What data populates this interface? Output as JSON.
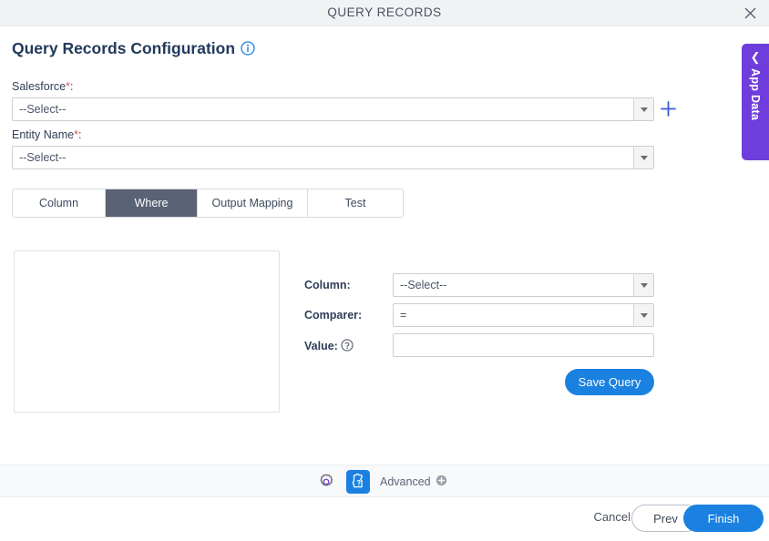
{
  "window": {
    "title": "QUERY RECORDS",
    "close_icon": "close-icon"
  },
  "page": {
    "heading": "Query Records Configuration",
    "info_icon": "info-icon"
  },
  "form": {
    "salesforce": {
      "label": "Salesforce",
      "required_mark": "*",
      "suffix": ":",
      "value": "--Select--",
      "add_icon": "plus-icon"
    },
    "entity_name": {
      "label": "Entity Name",
      "required_mark": "*",
      "suffix": ":",
      "value": "--Select--"
    }
  },
  "tabs": {
    "items": [
      {
        "label": "Column",
        "active": false
      },
      {
        "label": "Where",
        "active": true
      },
      {
        "label": "Output Mapping",
        "active": false
      },
      {
        "label": "Test",
        "active": false
      }
    ]
  },
  "criteria": {
    "list_items": [],
    "column": {
      "label": "Column:",
      "value": "--Select--"
    },
    "comparer": {
      "label": "Comparer:",
      "value": "="
    },
    "value": {
      "label": "Value:",
      "help_icon": "help-icon",
      "value": "",
      "placeholder": ""
    },
    "save_query_label": "Save Query"
  },
  "toolbar": {
    "settings_icon": "gear-icon",
    "snippet_icon": "puzzle-question-icon",
    "advanced_label": "Advanced",
    "advanced_add_icon": "plus-circle-icon"
  },
  "actions": {
    "cancel_label": "Cancel",
    "prev_label": "Prev",
    "finish_label": "Finish"
  },
  "side_panel": {
    "label": "App Data",
    "collapse_icon": "chevron-left-icon"
  },
  "colors": {
    "accent_blue": "#1a81e0",
    "active_tab": "#5a6275",
    "app_data_purple": "#6f3ddb",
    "required_red": "#d9534f",
    "heading_navy": "#23395b"
  }
}
